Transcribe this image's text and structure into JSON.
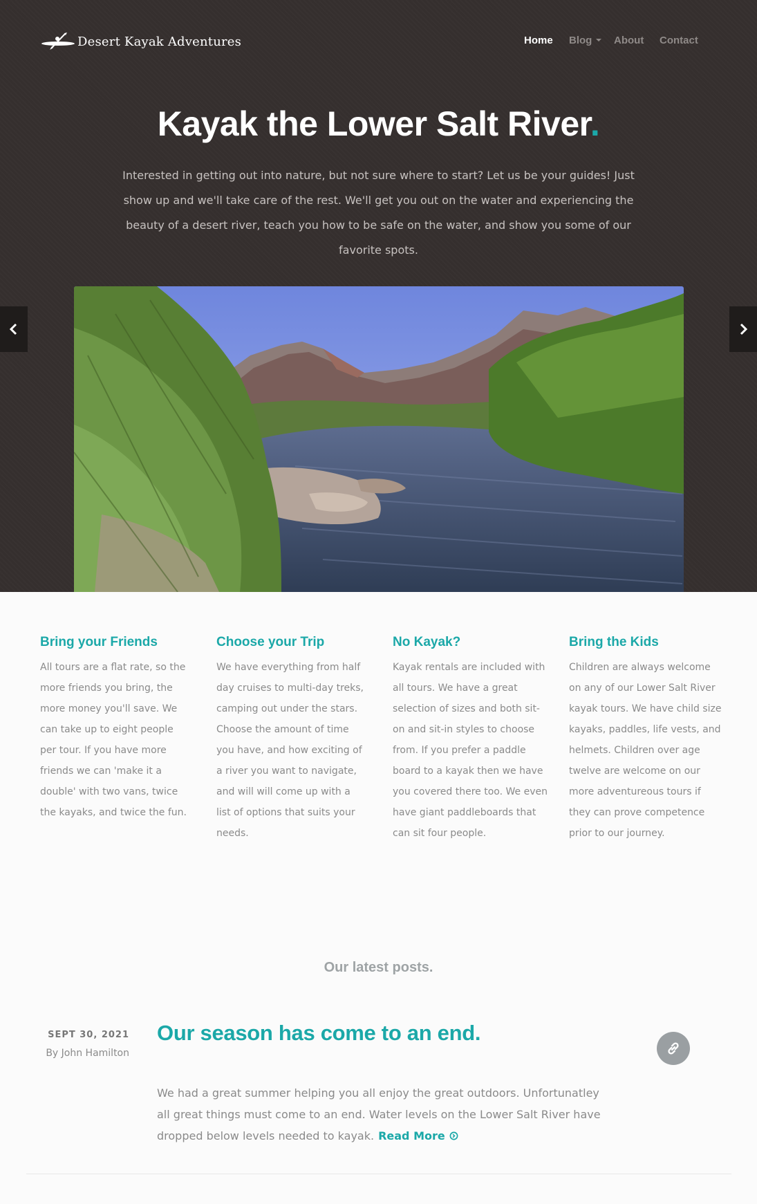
{
  "brand": {
    "name": "Desert Kayak Adventures",
    "logo_icon": "kayak-icon"
  },
  "nav": [
    {
      "label": "Home",
      "active": true
    },
    {
      "label": "Blog",
      "dropdown": true
    },
    {
      "label": "About"
    },
    {
      "label": "Contact"
    }
  ],
  "hero": {
    "title": "Kayak the Lower Salt River",
    "title_dot": ".",
    "description": "Interested in getting out into nature, but not sure where to start? Let us be your guides! Just show up and we'll take care of the rest. We'll get you out on the water and experiencing the beauty of a desert river, teach you how to be safe on the water, and show you some of our favorite spots.",
    "prev_icon": "chevron-left-icon",
    "next_icon": "chevron-right-icon"
  },
  "features": [
    {
      "title": "Bring your Friends",
      "text": "All tours are a flat rate, so the more friends you bring, the more money you'll save. We can take up to eight people per tour. If you have more friends we can 'make it a double' with two vans, twice the kayaks, and twice the fun."
    },
    {
      "title": "Choose your Trip",
      "text": "We have everything from half day cruises to multi-day treks, camping out under the stars. Choose the amount of time you have, and how exciting of a river you want to navigate, and will will come up with a list of options that suits your needs."
    },
    {
      "title": "No Kayak?",
      "text": "Kayak rentals are included with all tours. We have a great selection of sizes and both sit-on and sit-in styles to choose from. If you prefer a paddle board to a kayak then we have you covered there too. We even have giant paddleboards that can sit four people."
    },
    {
      "title": "Bring the Kids",
      "text": "Children are always welcome on any of our Lower Salt River kayak tours. We have child size kayaks, paddles, life vests, and helmets. Children over age twelve are welcome on our more adventureous tours if they can prove competence prior to our journey."
    }
  ],
  "latest_heading": "Our latest posts.",
  "post": {
    "date": "SEPT 30, 2021",
    "author": "By John Hamilton",
    "title": "Our season has come to an end.",
    "excerpt": "We had a great summer helping you all enjoy the great outdoors. Unfortunatley all great things must come to an end. Water levels on the Lower Salt River have dropped below levels needed to kayak.",
    "read_more": "Read More",
    "link_icon": "link-icon",
    "read_more_icon": "arrow-circle-icon"
  },
  "colors": {
    "accent": "#1ba8a8",
    "hero_bg": "#352f2e",
    "body_bg": "#fbfbfb"
  }
}
